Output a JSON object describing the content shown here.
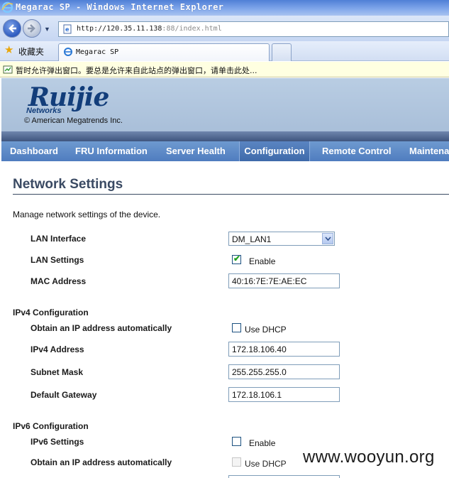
{
  "window": {
    "title": "Megarac SP - Windows Internet Explorer",
    "url_main": "http://120.35.11.138",
    "url_rest": ":88/index.html"
  },
  "favorites": {
    "label": "收藏夹"
  },
  "tab": {
    "title": "Megarac SP"
  },
  "infobar": {
    "text": "暂时允许弹出窗口。要总是允许来自此站点的弹出窗口，请单击此处..."
  },
  "header": {
    "logo_word": "Ruijie",
    "logo_sub": "Networks",
    "copyright": "© American Megatrends Inc."
  },
  "menu": {
    "items": [
      {
        "label": "Dashboard",
        "active": false
      },
      {
        "label": "FRU Information",
        "active": false
      },
      {
        "label": "Server Health",
        "active": false
      },
      {
        "label": "Configuration",
        "active": true
      },
      {
        "label": "Remote Control",
        "active": false
      },
      {
        "label": "Maintenance",
        "active": false
      }
    ]
  },
  "page": {
    "title": "Network Settings",
    "description": "Manage network settings of the device."
  },
  "lan": {
    "interface_label": "LAN Interface",
    "interface_value": "DM_LAN1",
    "settings_label": "LAN Settings",
    "settings_enable_label": "Enable",
    "settings_enabled": true,
    "mac_label": "MAC Address",
    "mac_value": "40:16:7E:7E:AE:EC"
  },
  "ipv4": {
    "section_title": "IPv4 Configuration",
    "auto_label": "Obtain an IP address automatically",
    "dhcp_label": "Use DHCP",
    "dhcp_checked": false,
    "address_label": "IPv4 Address",
    "address_value": "172.18.106.40",
    "subnet_label": "Subnet Mask",
    "subnet_value": "255.255.255.0",
    "gateway_label": "Default Gateway",
    "gateway_value": "172.18.106.1"
  },
  "ipv6": {
    "section_title": "IPv6 Configuration",
    "settings_label": "IPv6 Settings",
    "enable_label": "Enable",
    "enabled": false,
    "auto_label": "Obtain an IP address automatically",
    "dhcp_label": "Use DHCP",
    "dhcp_checked": false
  },
  "watermark": {
    "text": "www.wooyun.org"
  },
  "colors": {
    "menu_bar": "#4f7cbf",
    "header_bg": "#b9cde3",
    "title_text": "#3a4a63",
    "logo": "#123d7a"
  }
}
